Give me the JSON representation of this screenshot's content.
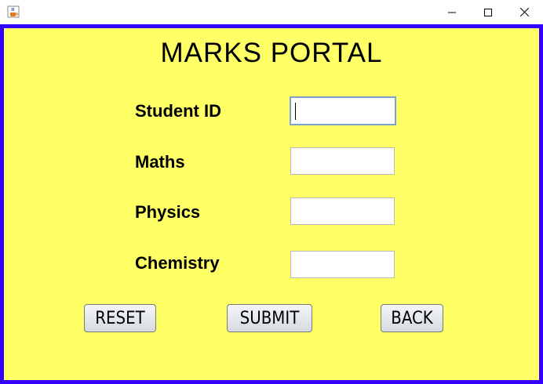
{
  "window": {
    "icon": "java-cup-icon",
    "controls": [
      "minimize-icon",
      "maximize-icon",
      "close-icon"
    ],
    "border_color": "#3300ff",
    "background_color": "#ffff66"
  },
  "form": {
    "title": "MARKS PORTAL",
    "fields": [
      {
        "label": "Student ID",
        "value": ""
      },
      {
        "label": "Maths",
        "value": ""
      },
      {
        "label": "Physics",
        "value": ""
      },
      {
        "label": "Chemistry",
        "value": ""
      }
    ]
  },
  "buttons": {
    "reset": "RESET",
    "submit": "SUBMIT",
    "back": "BACK"
  }
}
